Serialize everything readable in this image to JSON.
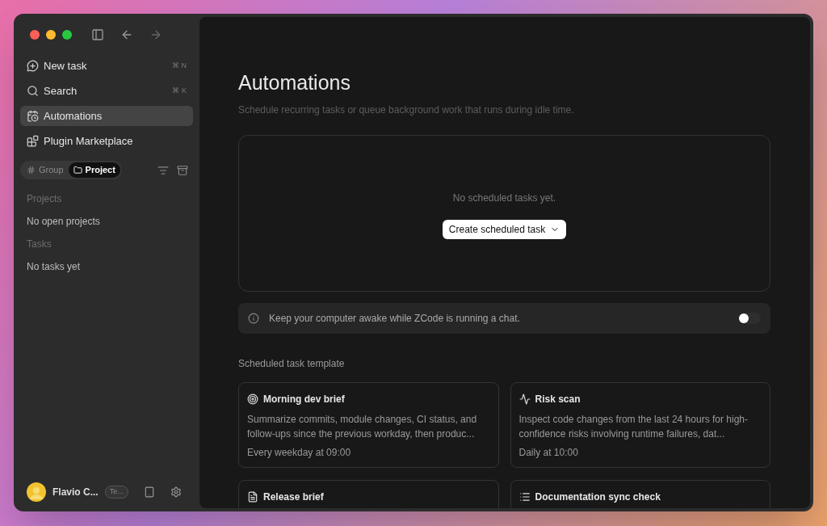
{
  "sidebar": {
    "nav": [
      {
        "label": "New task",
        "shortcut": "⌘ N",
        "selected": false
      },
      {
        "label": "Search",
        "shortcut": "⌘ K",
        "selected": false
      },
      {
        "label": "Automations",
        "selected": true
      },
      {
        "label": "Plugin Marketplace",
        "selected": false
      }
    ],
    "grouping": [
      {
        "label": "Group",
        "selected": false
      },
      {
        "label": "Project",
        "selected": true
      }
    ],
    "sections": [
      {
        "title": "Projects",
        "empty": "No open projects"
      },
      {
        "title": "Tasks",
        "empty": "No tasks yet"
      }
    ],
    "user": {
      "name": "Flavio C...",
      "badge": "Te..."
    }
  },
  "main": {
    "title": "Automations",
    "subtitle": "Schedule recurring tasks or queue background work that runs during idle time.",
    "empty_text": "No scheduled tasks yet.",
    "create_button": "Create scheduled task",
    "awake": {
      "text": "Keep your computer awake while ZCode is running a chat.",
      "on": false
    },
    "templates_heading": "Scheduled task template",
    "templates": [
      {
        "title": "Morning dev brief",
        "description": "Summarize commits, module changes, CI status, and follow-ups since the previous workday, then produc...",
        "schedule": "Every weekday at 09:00"
      },
      {
        "title": "Risk scan",
        "description": "Inspect code changes from the last 24 hours for high-confidence risks involving runtime failures, dat...",
        "schedule": "Daily at 10:00"
      },
      {
        "title": "Release brief"
      },
      {
        "title": "Documentation sync check"
      }
    ]
  }
}
